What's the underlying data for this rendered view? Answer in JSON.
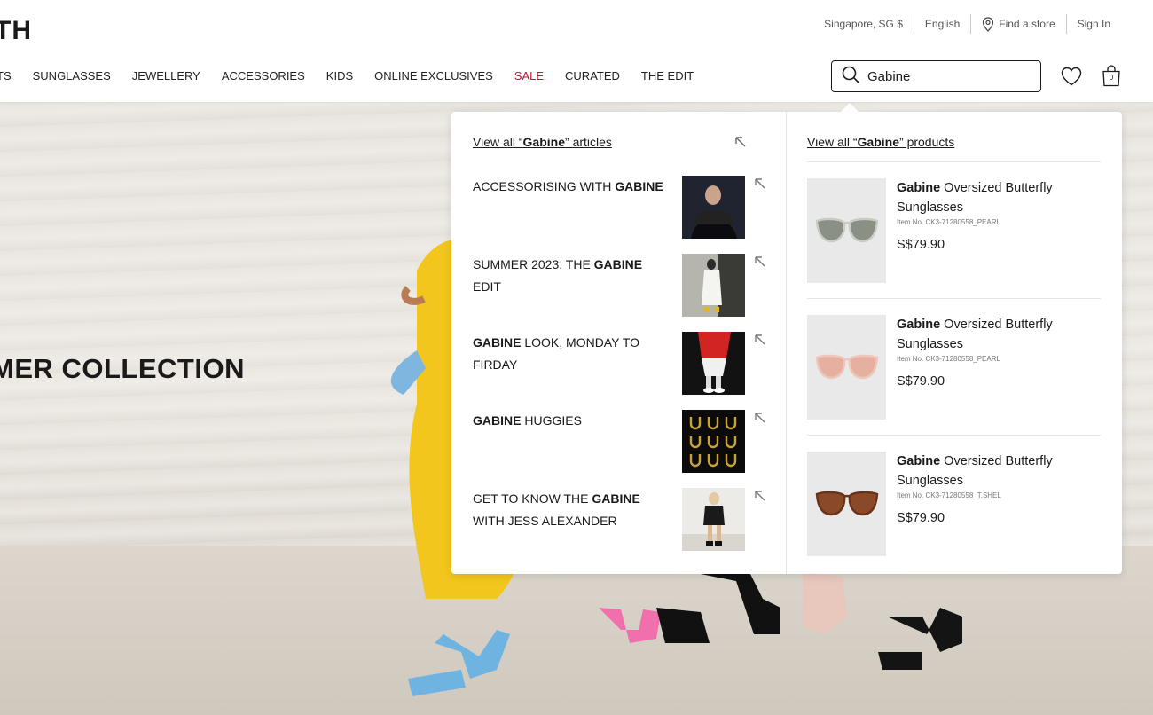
{
  "brand": {
    "logo_text": "TH"
  },
  "utility_bar": {
    "region": "Singapore, SG $",
    "language": "English",
    "find_store": "Find a store",
    "sign_in": "Sign In"
  },
  "nav": {
    "items": [
      "TS",
      "SUNGLASSES",
      "JEWELLERY",
      "ACCESSORIES",
      "KIDS",
      "ONLINE EXCLUSIVES",
      "SALE",
      "CURATED",
      "THE EDIT"
    ]
  },
  "search": {
    "query": "Gabine",
    "placeholder": ""
  },
  "bag": {
    "count": "0"
  },
  "hero": {
    "title": "MER COLLECTION"
  },
  "dropdown": {
    "articles_link": {
      "prefix": "View all “",
      "term": "Gabine",
      "suffix": "” articles"
    },
    "products_link": {
      "prefix": "View all “",
      "term": "Gabine",
      "suffix": "” products"
    },
    "articles": [
      {
        "pre": "ACCESSORISING WITH ",
        "bold": "GABINE",
        "post": "",
        "thumb": "portrait-dark"
      },
      {
        "pre": "SUMMER 2023: THE ",
        "bold": "GABINE",
        "post": " EDIT",
        "thumb": "street-white"
      },
      {
        "pre": "",
        "bold": "GABINE",
        "post": " LOOK, MONDAY TO FIRDAY",
        "thumb": "red-skirt"
      },
      {
        "pre": "",
        "bold": "GABINE",
        "post": " HUGGIES",
        "thumb": "earrings-grid"
      },
      {
        "pre": "GET TO KNOW THE ",
        "bold": "GABINE",
        "post": " WITH JESS ALEXANDER",
        "thumb": "woman-studio"
      }
    ],
    "products": [
      {
        "bold": "Gabine",
        "name": " Oversized Butterfly Sunglasses",
        "sku": "Item No. CK3-71280558_PEARL",
        "price": "S$79.90",
        "lens_color": "#8a9083",
        "frame_color": "#c7cdc2"
      },
      {
        "bold": "Gabine",
        "name": " Oversized Butterfly Sunglasses",
        "sku": "Item No. CK3-71280558_PEARL",
        "price": "S$79.90",
        "lens_color": "#e6b0a0",
        "frame_color": "#eec6ba"
      },
      {
        "bold": "Gabine",
        "name": " Oversized Butterfly Sunglasses",
        "sku": "Item No. CK3-71280558_T.SHEL",
        "price": "S$79.90",
        "lens_color": "#8a4a2a",
        "frame_color": "#6b3218"
      }
    ]
  }
}
